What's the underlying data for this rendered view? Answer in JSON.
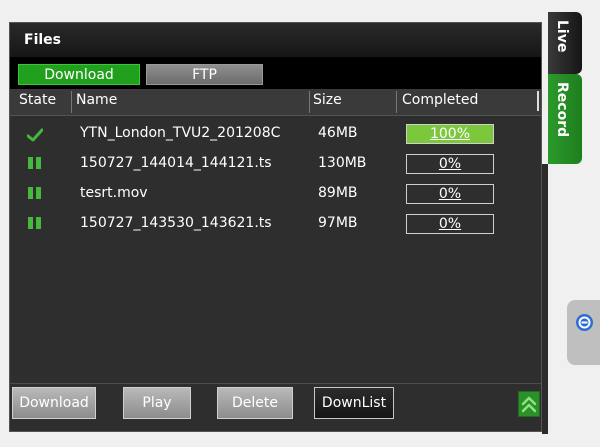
{
  "panel": {
    "title": "Files"
  },
  "tabs": [
    {
      "label": "Download",
      "active": true
    },
    {
      "label": "FTP",
      "active": false
    }
  ],
  "table": {
    "headers": [
      "State",
      "Name",
      "Size",
      "Completed"
    ],
    "rows": [
      {
        "state": "complete",
        "name": "YTN_London_TVU2_201208C",
        "size": "46MB",
        "completed": "100%",
        "progress": 1.0
      },
      {
        "state": "paused",
        "name": "150727_144014_144121.ts",
        "size": "130MB",
        "completed": "0%",
        "progress": 0.0
      },
      {
        "state": "paused",
        "name": "tesrt.mov",
        "size": "89MB",
        "completed": "0%",
        "progress": 0.0
      },
      {
        "state": "paused",
        "name": "150727_143530_143621.ts",
        "size": "97MB",
        "completed": "0%",
        "progress": 0.0
      }
    ]
  },
  "buttons": {
    "download": "Download",
    "play": "Play",
    "delete": "Delete",
    "downlist": "DownList"
  },
  "side_tabs": {
    "live": "Live",
    "record": "Record"
  },
  "colors": {
    "accent_green": "#21a01e",
    "progress_fill": "#7cc83c",
    "state_green": "#46b83e",
    "record_icon_blue": "#2b6ed6"
  },
  "icons": {
    "complete_state": "checkmark-icon",
    "paused_state": "pause-icon",
    "scroll_top": "double-chevron-up-icon",
    "record_indicator": "record-icon"
  }
}
